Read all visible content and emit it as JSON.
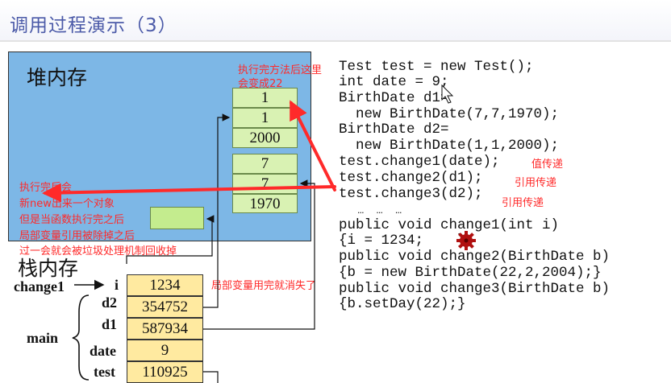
{
  "slide": {
    "title": "调用过程演示（3）"
  },
  "heap": {
    "label": "堆内存",
    "obj1": [
      "1",
      "1",
      "2000"
    ],
    "obj2": [
      "7",
      "7",
      "1970"
    ]
  },
  "stack": {
    "label": "栈内存",
    "change1_label": "change1",
    "main_label": "main",
    "vars": [
      {
        "name": "i",
        "value": "1234"
      },
      {
        "name": "d2",
        "value": "354752"
      },
      {
        "name": "d1",
        "value": "587934"
      },
      {
        "name": "date",
        "value": "9"
      },
      {
        "name": "test",
        "value": "110925"
      }
    ]
  },
  "code": {
    "lines": [
      "Test test = new Test();",
      "int date = 9;",
      "BirthDate d1=",
      "  new BirthDate(7,7,1970);",
      "BirthDate d2=",
      "  new BirthDate(1,1,2000);",
      "test.change1(date);",
      "test.change2(d1);",
      "test.change3(d2);",
      "   …  …  …",
      "public void change1(int i)",
      "{i = 1234;    }",
      "public void change2(BirthDate b)",
      "{b = new BirthDate(22,2,2004);}",
      "public void change3(BirthDate b)",
      "{b.setDay(22);}"
    ]
  },
  "notes": {
    "top_1": "执行完方法后这里",
    "top_2": "会变成22",
    "value_pass": "值传递",
    "ref_pass_1": "引用传递",
    "ref_pass_2": "引用传递",
    "left_1": "执行完后会",
    "left_2": "新new出来一个对象",
    "left_3": "但是当函数执行完之后",
    "left_4": "局部变量引用被除掉之后",
    "left_5": "过一会就会被垃圾处理机制回收掉",
    "local_var": "局部变量用完就消失了"
  },
  "colors": {
    "heap_bg": "#7db7e6",
    "stack_cell": "#ffeaa0",
    "object_cell": "#d9f2b3",
    "annotation": "#ff2a2a",
    "title": "#4b5aa8"
  }
}
